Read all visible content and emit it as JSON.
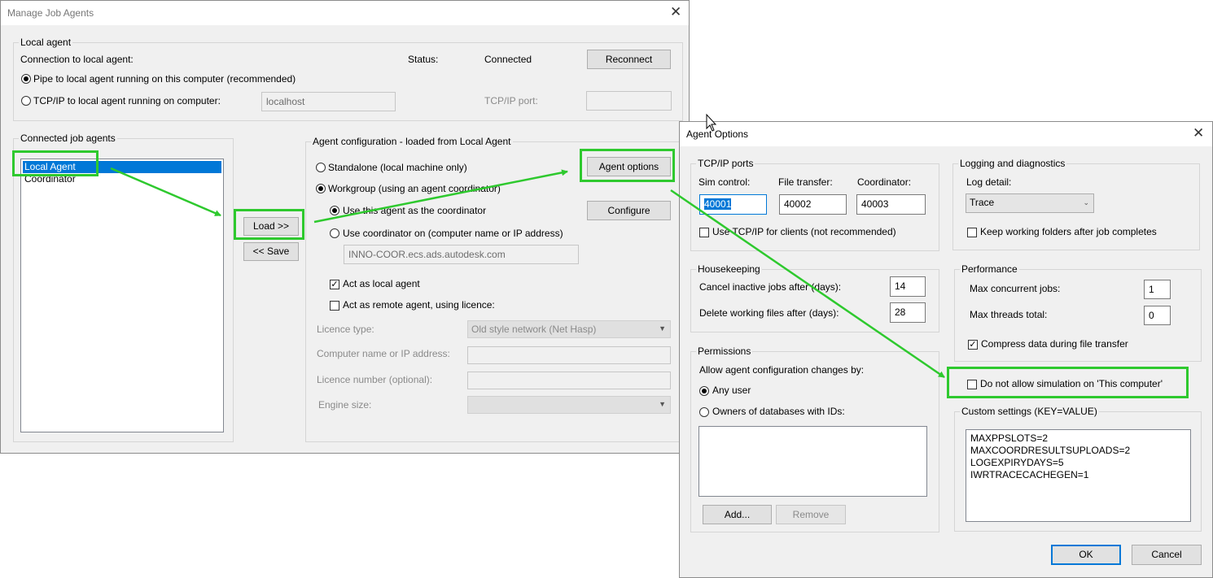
{
  "manage": {
    "title": "Manage Job Agents",
    "local_agent": {
      "group": "Local agent",
      "connection_label": "Connection to local agent:",
      "status_label": "Status:",
      "status_value": "Connected",
      "reconnect": "Reconnect",
      "pipe_option": "Pipe to local agent running on this computer (recommended)",
      "tcp_option": "TCP/IP to local agent running on computer:",
      "tcp_host_value": "localhost",
      "tcp_port_label": "TCP/IP port:",
      "tcp_port_value": ""
    },
    "connected": {
      "group": "Connected job agents",
      "items": [
        {
          "label": "Local Agent",
          "selected": true
        },
        {
          "label": "Coordinator",
          "selected": false
        }
      ]
    },
    "load_button": "Load >>",
    "save_button": "<< Save",
    "config": {
      "group": "Agent configuration - loaded from Local Agent",
      "standalone": "Standalone (local machine only)",
      "workgroup": "Workgroup (using an agent coordinator)",
      "use_this_coord": "Use this agent as the coordinator",
      "use_coord_on": "Use coordinator on (computer name or IP address)",
      "coord_value": "INNO-COOR.ecs.ads.autodesk.com",
      "agent_options": "Agent options",
      "configure": "Configure",
      "act_local": "Act as local agent",
      "act_remote": "Act as remote agent, using licence:",
      "licence_type_label": "Licence type:",
      "licence_type_value": "Old style network (Net Hasp)",
      "computer_label": "Computer name or IP address:",
      "licence_number_label": "Licence number (optional):",
      "engine_size_label": "Engine size:"
    }
  },
  "options": {
    "title": "Agent Options",
    "tcp": {
      "group": "TCP/IP ports",
      "sim_label": "Sim control:",
      "sim_value": "40001",
      "file_label": "File transfer:",
      "file_value": "40002",
      "coord_label": "Coordinator:",
      "coord_value": "40003",
      "use_tcp": "Use TCP/IP for clients (not recommended)"
    },
    "logging": {
      "group": "Logging and diagnostics",
      "log_detail_label": "Log detail:",
      "log_detail_value": "Trace",
      "keep_folders": "Keep working folders after job completes"
    },
    "housekeeping": {
      "group": "Housekeeping",
      "cancel_label": "Cancel inactive jobs after (days):",
      "cancel_value": "14",
      "delete_label": "Delete working files after (days):",
      "delete_value": "28"
    },
    "performance": {
      "group": "Performance",
      "max_jobs_label": "Max concurrent jobs:",
      "max_jobs_value": "1",
      "max_threads_label": "Max threads total:",
      "max_threads_value": "0",
      "compress": "Compress data during file transfer"
    },
    "permissions": {
      "group": "Permissions",
      "allow_label": "Allow agent configuration changes by:",
      "any_user": "Any user",
      "owners": "Owners of databases with IDs:",
      "add": "Add...",
      "remove": "Remove"
    },
    "no_sim": "Do not allow simulation on 'This computer'",
    "custom": {
      "group": "Custom settings (KEY=VALUE)",
      "lines": [
        "MAXPPSLOTS=2",
        "MAXCOORDRESULTSUPLOADS=2",
        "LOGEXPIRYDAYS=5",
        "IWRTRACECACHEGEN=1"
      ]
    },
    "ok": "OK",
    "cancel": "Cancel"
  },
  "colors": {
    "highlight": "#2ec92e",
    "selection": "#0078d7"
  }
}
